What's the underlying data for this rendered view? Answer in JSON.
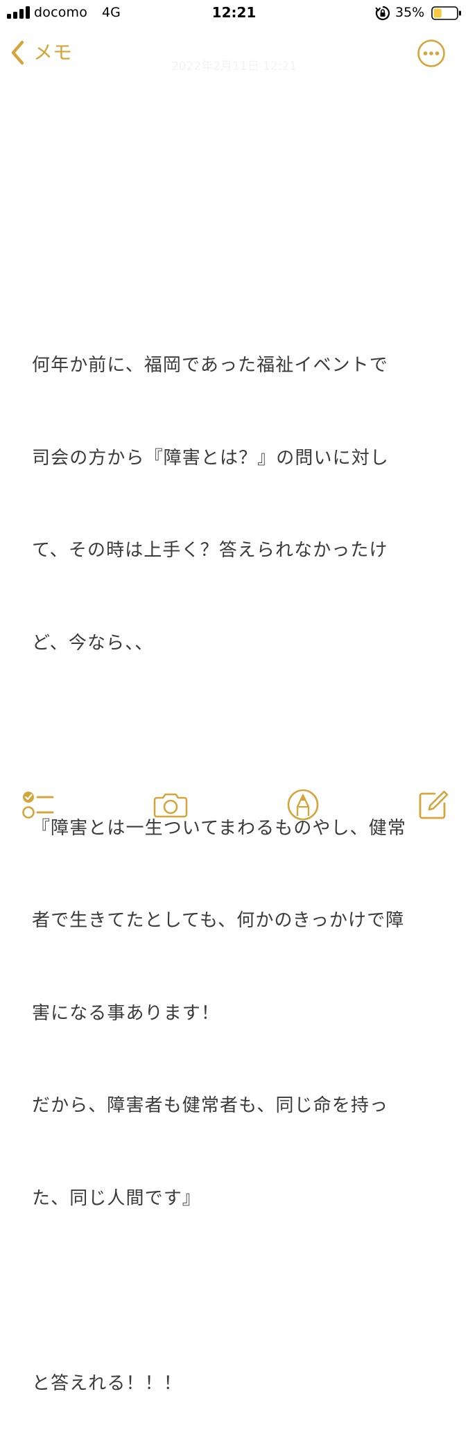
{
  "status_bar": {
    "carrier": "docomo",
    "network": "4G",
    "time": "12:21",
    "battery_percent": "35%",
    "battery_level": 0.35,
    "icons": [
      "signal-icon",
      "rotation-lock-icon",
      "battery-icon"
    ]
  },
  "nav": {
    "back_label": "メモ",
    "date": "2022年2月11日 12:21",
    "icons": [
      "chevron-left-icon",
      "more-icon"
    ]
  },
  "note": {
    "lines": [
      "何年か前に、福岡であった福祉イベントで",
      "司会の方から『障害とは？』の問いに対し",
      "て、その時は上手く？答えられなかったけ",
      "ど、今なら、、",
      "",
      "『障害とは一生ついてまわるものやし、健常",
      "者で生きてたとしても、何かのきっかけで障",
      "害になる事あります！",
      "だから、障害者も健常者も、同じ命を持っ",
      "た、同じ人間です』",
      "",
      "と答えれる！！！"
    ]
  },
  "toolbar": {
    "icons": [
      "checklist-icon",
      "camera-icon",
      "markup-icon",
      "compose-icon"
    ]
  },
  "colors": {
    "accent": "#d4a53b",
    "text": "#3a3a3c",
    "background": "#ffffff"
  }
}
